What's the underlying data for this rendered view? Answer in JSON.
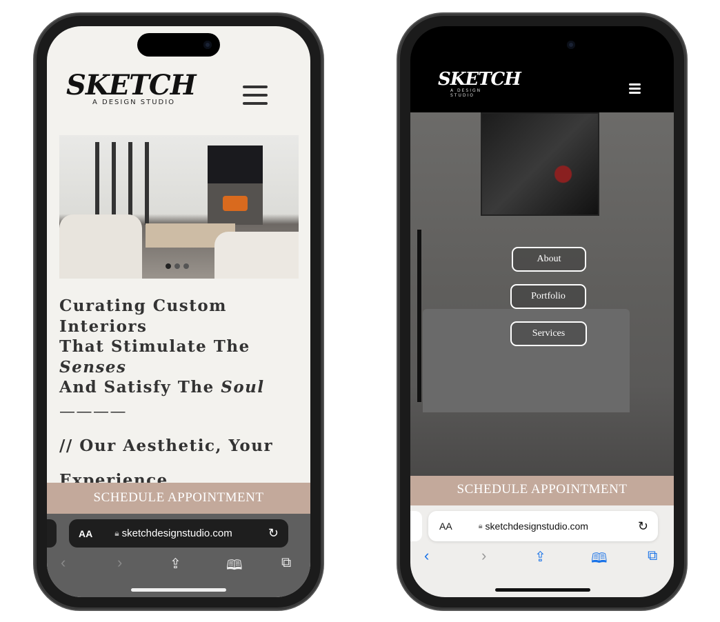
{
  "site": {
    "logo_main": "SKETCH",
    "logo_sub": "A DESIGN STUDIO",
    "url": "sketchdesignstudio.com",
    "schedule_label": "SCHEDULE APPOINTMENT"
  },
  "left": {
    "headline_lines": [
      "Curating Custom",
      "Interiors",
      "That Stimulate The"
    ],
    "headline_italic_senses": "Senses",
    "headline_line5": "And Satisfy The ",
    "headline_italic_soul": "Soul",
    "divider": "————",
    "subheading_1": "//  Our Aesthetic, Your",
    "subheading_2": "Experience",
    "carousel_dots": 3
  },
  "right": {
    "menu": [
      {
        "label": "About"
      },
      {
        "label": "Portfolio"
      },
      {
        "label": "Services"
      }
    ]
  },
  "safari": {
    "aa": "AA",
    "icons": [
      "chevron-left",
      "chevron-right",
      "share",
      "bookmarks",
      "tabs",
      "reload",
      "lock"
    ]
  },
  "colors": {
    "banner": "#c3a99b",
    "cream": "#f3f2ee",
    "safari_blue": "#1a73e8"
  }
}
